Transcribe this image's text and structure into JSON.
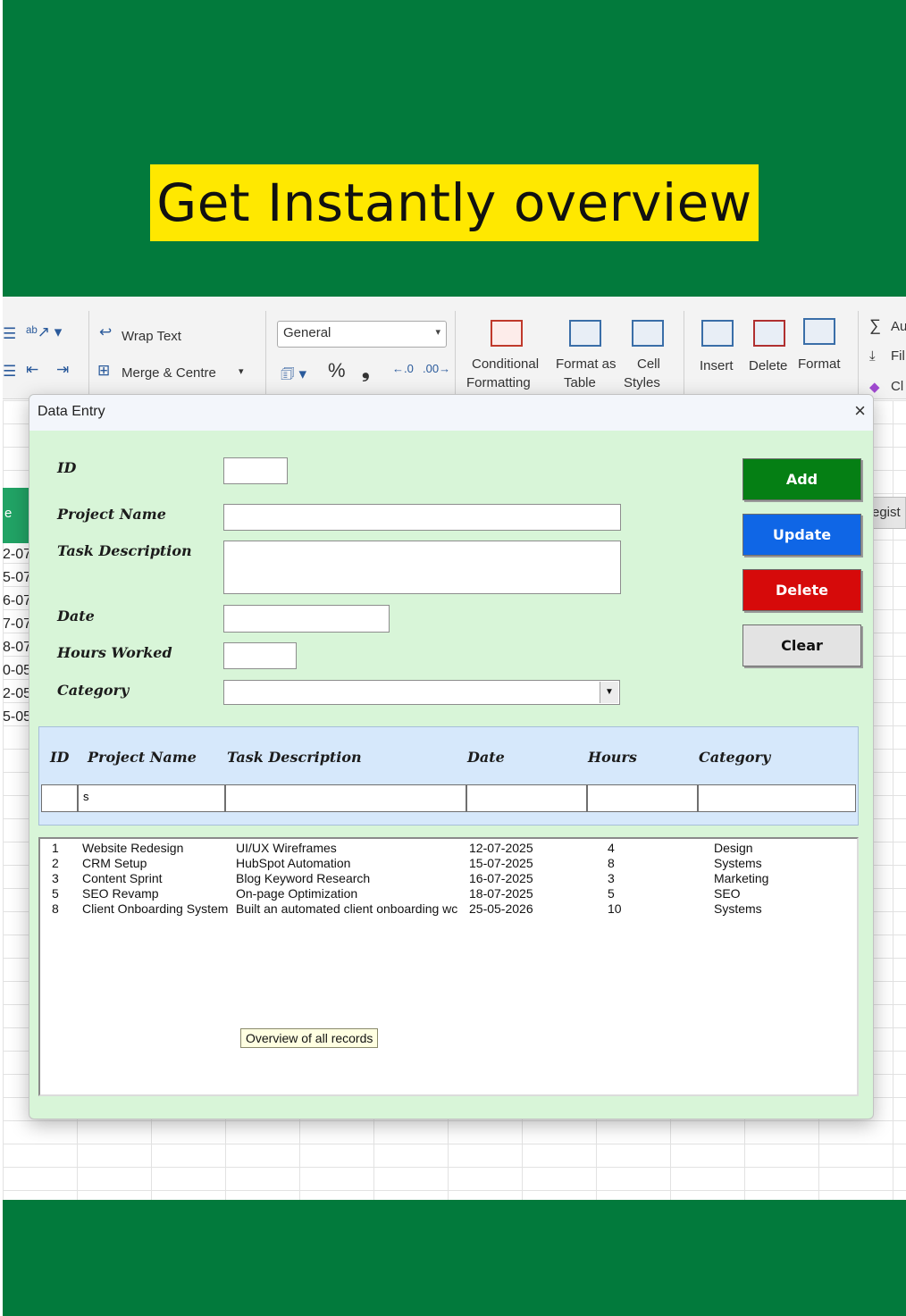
{
  "banner": {
    "headline": "Get Instantly overview"
  },
  "colors": {
    "band_green": "#027a3c",
    "headline_yellow": "#ffe800",
    "dialog_bg": "#d8f5d8",
    "add": "#057f14",
    "update": "#0f66e6",
    "delete": "#d60a0a",
    "clear": "#e3e3e3"
  },
  "ribbon": {
    "wrap_text": "Wrap Text",
    "merge_centre": "Merge & Centre",
    "number_format": "General",
    "percent": "%",
    "comma": "❟",
    "conditional_1": "Conditional",
    "conditional_2": "Formatting",
    "format_as_1": "Format as",
    "format_as_2": "Table",
    "cell_1": "Cell",
    "cell_2": "Styles",
    "insert": "Insert",
    "delete": "Delete",
    "format": "Format",
    "autosum": "Au",
    "fill": "Fil",
    "clear": "Cl"
  },
  "sheet": {
    "green_cell": "e",
    "left_values": [
      "2-07",
      "5-07",
      "6-07",
      "7-07",
      "8-07",
      "0-05",
      "2-05",
      "5-05"
    ],
    "regist_button": "egist"
  },
  "dialog": {
    "title": "Data Entry",
    "close": "×",
    "labels": {
      "id": "ID",
      "project_name": "Project Name",
      "task_description": "Task Description",
      "date": "Date",
      "hours_worked": "Hours Worked",
      "category": "Category"
    },
    "values": {
      "id": "",
      "project_name": "",
      "task_description": "",
      "date": "",
      "hours_worked": "",
      "category": ""
    },
    "buttons": {
      "add": "Add",
      "update": "Update",
      "delete": "Delete",
      "clear": "Clear"
    },
    "filter_headers": [
      "ID",
      "Project Name",
      "Task Description",
      "Date",
      "Hours",
      "Category"
    ],
    "filter_values": [
      "",
      "s",
      "",
      "",
      "",
      ""
    ],
    "records": [
      [
        "1",
        "Website Redesign",
        "UI/UX Wireframes",
        "12-07-2025",
        "4",
        "Design"
      ],
      [
        "2",
        "CRM Setup",
        "HubSpot Automation",
        "15-07-2025",
        "8",
        "Systems"
      ],
      [
        "3",
        "Content Sprint",
        "Blog Keyword Research",
        "16-07-2025",
        "3",
        "Marketing"
      ],
      [
        "5",
        "SEO Revamp",
        "On-page Optimization",
        "18-07-2025",
        "5",
        "SEO"
      ],
      [
        "8",
        "Client Onboarding System",
        "Built an automated client onboarding wc",
        "25-05-2026",
        "10",
        "Systems"
      ]
    ],
    "tooltip": "Overview of all records"
  }
}
